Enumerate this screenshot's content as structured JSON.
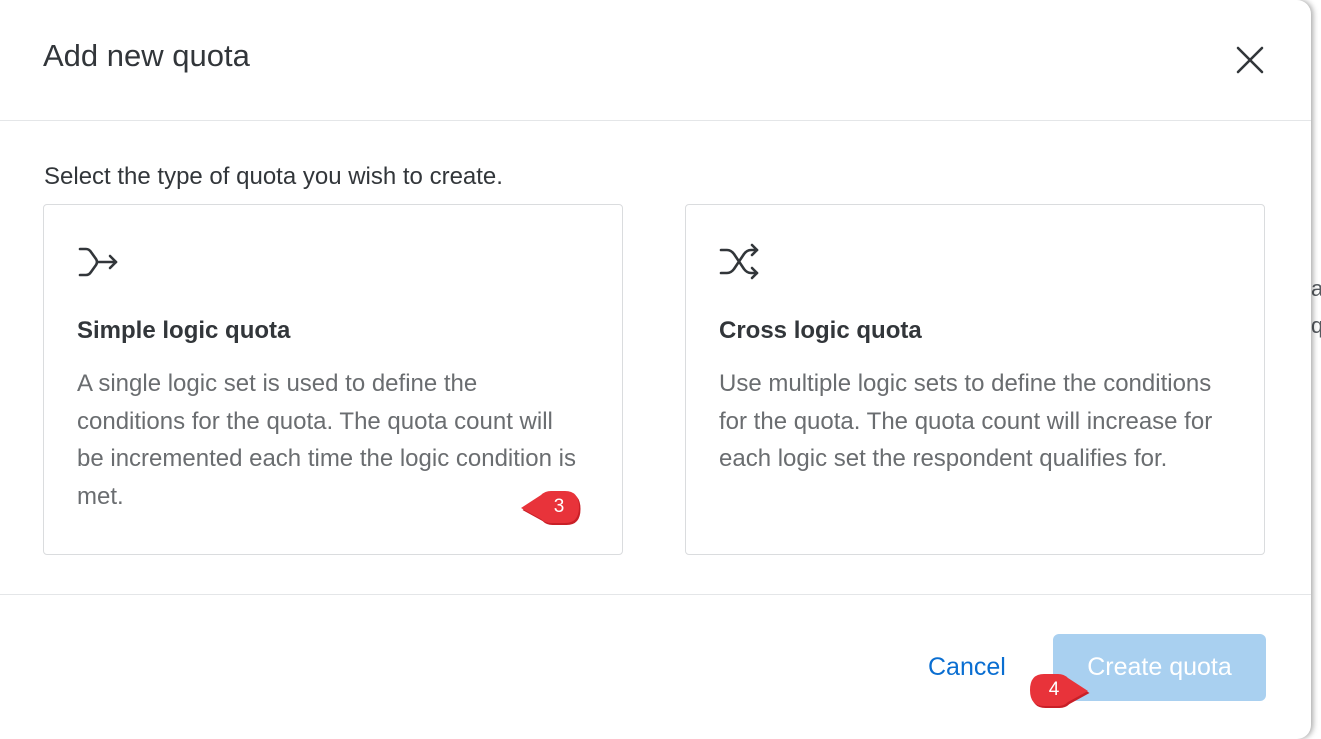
{
  "dialog": {
    "title": "Add new quota",
    "close_icon": "close-icon",
    "prompt": "Select the type of quota you wish to create."
  },
  "options": [
    {
      "icon": "merge-arrow-icon",
      "title": "Simple logic quota",
      "description": "A single logic set is used to define the conditions for the quota. The quota count will be incremented each time the logic condition is met."
    },
    {
      "icon": "shuffle-icon",
      "title": "Cross logic quota",
      "description": "Use multiple logic sets to define the conditions for the quota. The quota count will increase for each logic set the respondent qualifies for."
    }
  ],
  "footer": {
    "cancel_label": "Cancel",
    "create_label": "Create quota",
    "create_disabled": true
  },
  "callouts": [
    {
      "label": "3"
    },
    {
      "label": "4"
    }
  ],
  "background_fragments": [
    "a",
    "q"
  ],
  "colors": {
    "accent": "#0a6ed1",
    "primary_disabled": "#a9d0f0",
    "callout": "#e8333a",
    "text": "#32363a",
    "muted_text": "#6a6d70",
    "border": "#dadcde"
  }
}
